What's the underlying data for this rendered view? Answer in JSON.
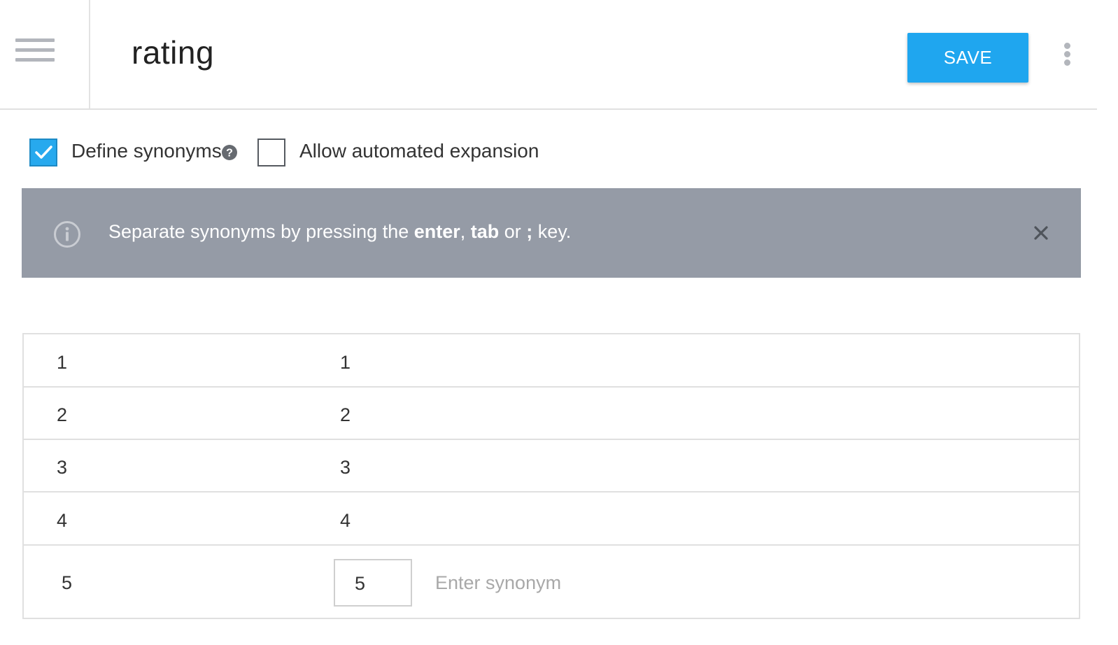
{
  "header": {
    "menu_icon": "hamburger-icon",
    "title": "rating",
    "save_label": "SAVE",
    "more_icon": "more-vert-icon"
  },
  "options": {
    "define_synonyms": {
      "label": "Define synonyms",
      "checked": true,
      "help_icon": "help-circle-icon"
    },
    "allow_expansion": {
      "label": "Allow automated expansion",
      "checked": false
    }
  },
  "banner": {
    "icon": "info-icon",
    "text_before": "Separate synonyms by pressing the ",
    "key_enter": "enter",
    "sep_comma": ", ",
    "key_tab": "tab",
    "text_or": " or ",
    "key_semicolon": ";",
    "text_after": " key.",
    "close_icon": "close-icon",
    "background": "#959ba6"
  },
  "entries": [
    {
      "value": "1",
      "synonym": "1"
    },
    {
      "value": "2",
      "synonym": "2"
    },
    {
      "value": "3",
      "synonym": "3"
    },
    {
      "value": "4",
      "synonym": "4"
    },
    {
      "value": "5",
      "synonym": "5",
      "input_placeholder": "Enter synonym"
    }
  ],
  "colors": {
    "accent": "#1fa6ef",
    "checkbox": "#27a9ee"
  }
}
